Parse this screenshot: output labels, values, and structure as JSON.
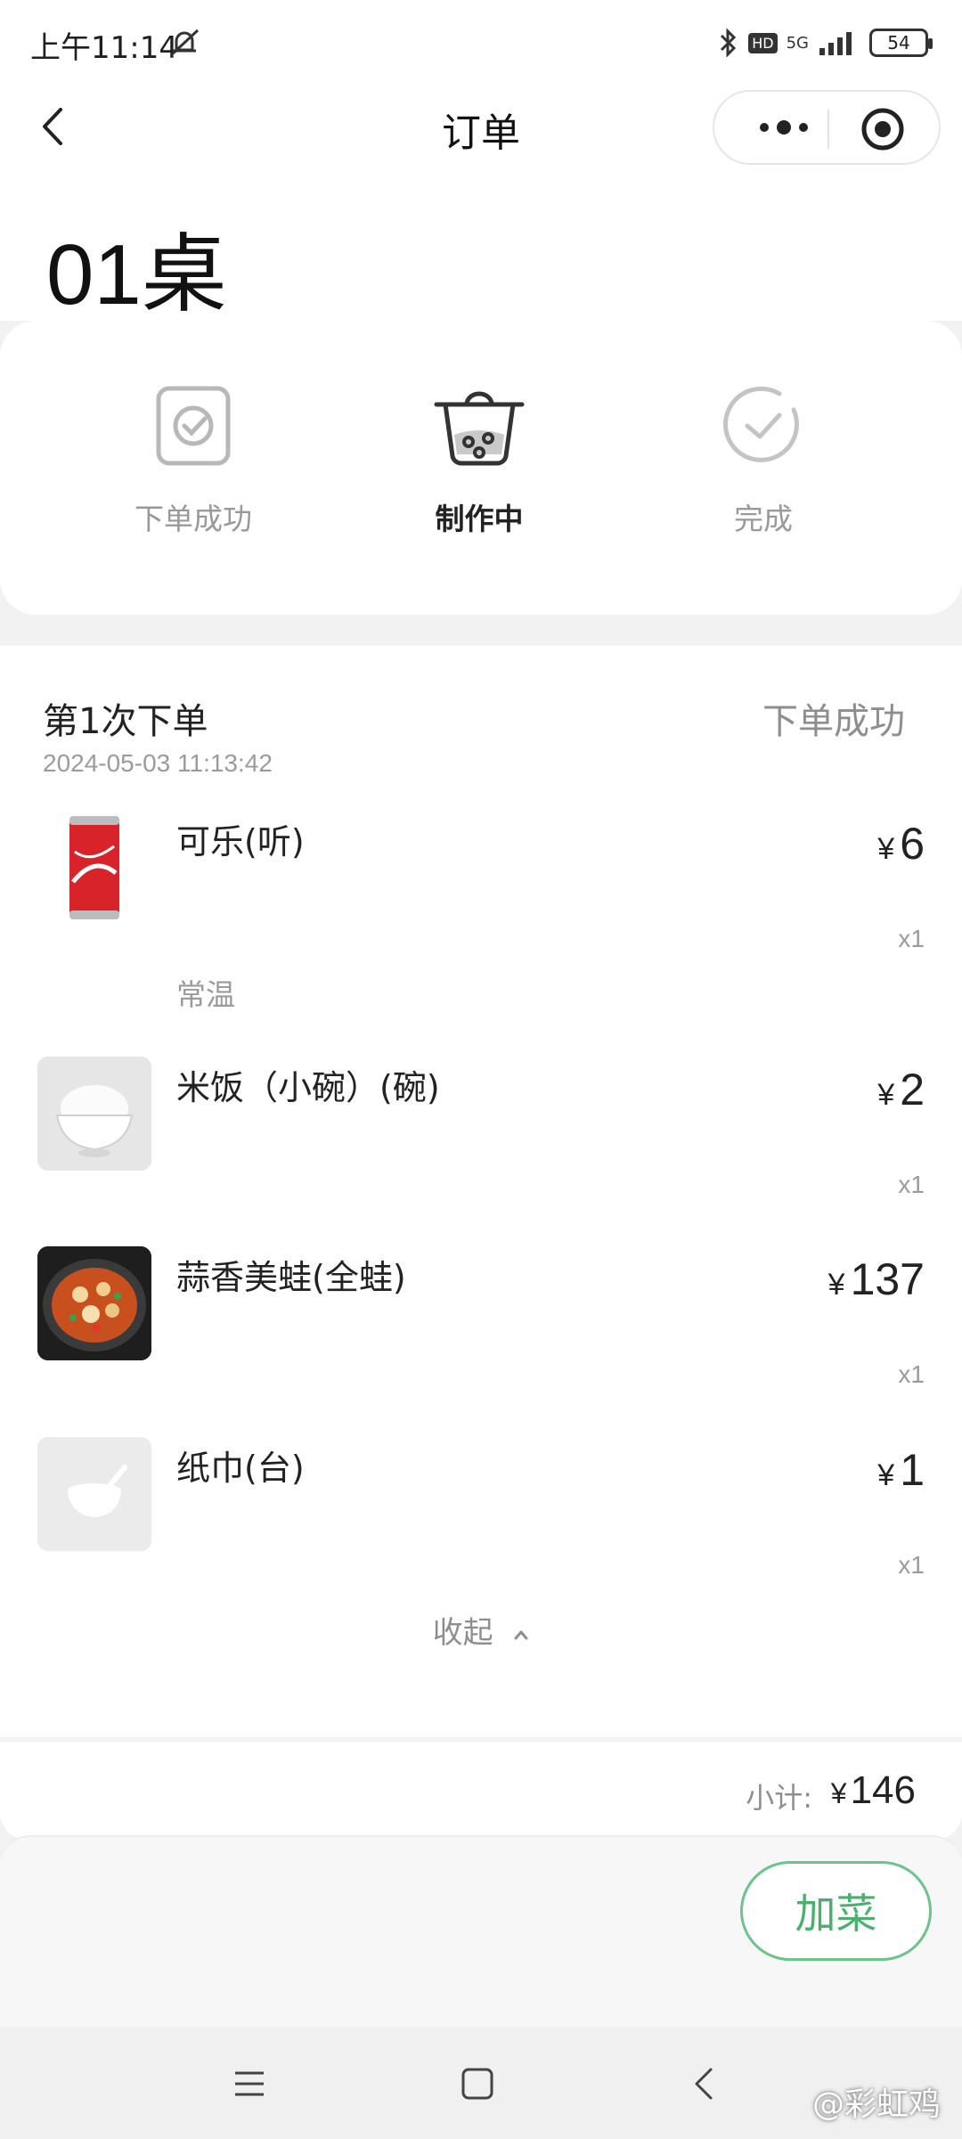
{
  "status_bar": {
    "time": "上午11:14",
    "network": "5G",
    "hd": "HD",
    "battery": "54"
  },
  "nav": {
    "title": "订单"
  },
  "header": {
    "table_name": "01桌"
  },
  "progress": {
    "steps": [
      {
        "label": "下单成功",
        "icon": "order-check-icon",
        "active": false
      },
      {
        "label": "制作中",
        "icon": "cooking-pot-icon",
        "active": true
      },
      {
        "label": "完成",
        "icon": "complete-check-icon",
        "active": false
      }
    ]
  },
  "order": {
    "round_label": "第1次下单",
    "state": "下单成功",
    "time": "2024-05-03 11:13:42",
    "currency": "¥",
    "items": [
      {
        "name": "可乐(听)",
        "price": "6",
        "qty": "x1",
        "spec": "常温"
      },
      {
        "name": "米饭（小碗）(碗)",
        "price": "2",
        "qty": "x1"
      },
      {
        "name": "蒜香美蛙(全蛙)",
        "price": "137",
        "qty": "x1"
      },
      {
        "name": "纸巾(台)",
        "price": "1",
        "qty": "x1"
      }
    ],
    "collapse_label": "收起"
  },
  "summary": {
    "subtotal_label": "小计:",
    "subtotal_value": "146"
  },
  "actions": {
    "add_label": "加菜"
  },
  "watermark": "@彩虹鸡",
  "colors": {
    "accent_green": "#4bb06d",
    "text_primary": "#222222",
    "text_secondary": "#9b9b9b"
  }
}
